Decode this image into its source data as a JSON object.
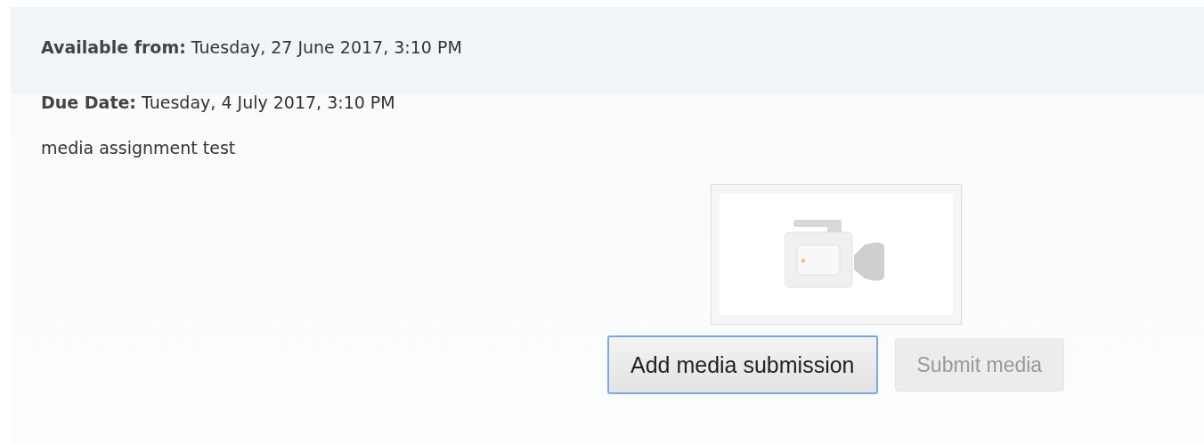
{
  "dates": [
    {
      "label": "Available from:",
      "value": "Tuesday, 27 June 2017, 3:10 PM"
    },
    {
      "label": "Due Date:",
      "value": "Tuesday, 4 July 2017, 3:10 PM"
    }
  ],
  "description": "media assignment test",
  "media_preview": {
    "kind": "video"
  },
  "buttons": [
    {
      "label": "Add media submission",
      "disabled": false,
      "focused": true
    },
    {
      "label": "Submit media",
      "disabled": true,
      "focused": false
    }
  ]
}
